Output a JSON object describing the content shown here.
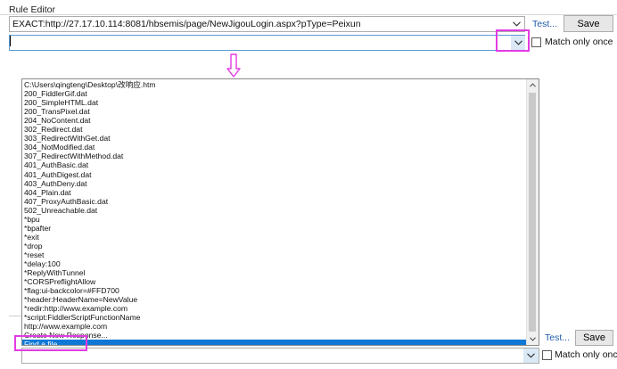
{
  "panel": {
    "title": "Rule Editor"
  },
  "match_combo": {
    "value": "EXACT:http://27.17.10.114:8081/hbsemis/page/NewJigouLogin.aspx?pType=Peixun"
  },
  "test_link": "Test...",
  "save_label": "Save",
  "match_only_once_label": "Match only once",
  "dropdown_items": [
    "C:\\Users\\qingteng\\Desktop\\改响应.htm",
    "200_FiddlerGif.dat",
    "200_SimpleHTML.dat",
    "200_TransPixel.dat",
    "204_NoContent.dat",
    "302_Redirect.dat",
    "303_RedirectWithGet.dat",
    "304_NotModified.dat",
    "307_RedirectWithMethod.dat",
    "401_AuthBasic.dat",
    "401_AuthDigest.dat",
    "403_AuthDeny.dat",
    "404_Plain.dat",
    "407_ProxyAuthBasic.dat",
    "502_Unreachable.dat",
    "*bpu",
    "*bpafter",
    "*exit",
    "*drop",
    "*reset",
    "*delay:100",
    "*ReplyWithTunnel",
    "*CORSPreflightAllow",
    "*flag:ui-backcolor=#FFD700",
    "*header:HeaderName=NewValue",
    "*redir:http://www.example.com",
    "*script:FiddlerScriptFunctionName",
    "http://www.example.com",
    "Create New Response...",
    "Find a file..."
  ],
  "selected_index": 29,
  "colors": {
    "highlight": "#e33be3",
    "selection": "#0f78d7",
    "link": "#1f5aa6"
  },
  "icons": {
    "combo_arrow": "chevron-down-icon",
    "flow_arrow": "arrow-down-outline-icon",
    "scroll_up": "scroll-up-arrow-icon",
    "scroll_down": "scroll-down-arrow-icon"
  }
}
